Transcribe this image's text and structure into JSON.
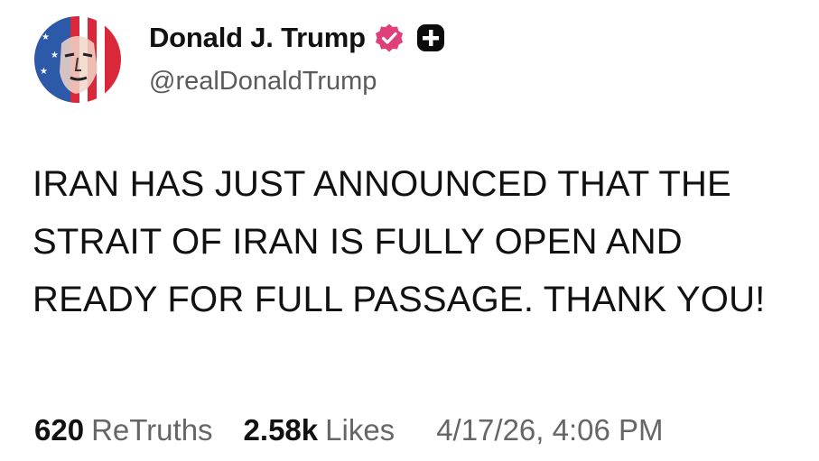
{
  "author": {
    "display_name": "Donald J. Trump",
    "handle": "@realDonaldTrump",
    "verified_badge": "verified-badge-icon",
    "plus_badge": "plus-badge-icon",
    "verified_color": "#e0407a"
  },
  "post": {
    "text": "IRAN HAS JUST ANNOUNCED THAT THE STRAIT OF IRAN IS FULLY OPEN AND READY FOR FULL PASSAGE. THANK YOU!"
  },
  "stats": {
    "retruths_count": "620",
    "retruths_label": "ReTruths",
    "likes_count": "2.58k",
    "likes_label": "Likes",
    "timestamp": "4/17/26, 4:06 PM"
  }
}
